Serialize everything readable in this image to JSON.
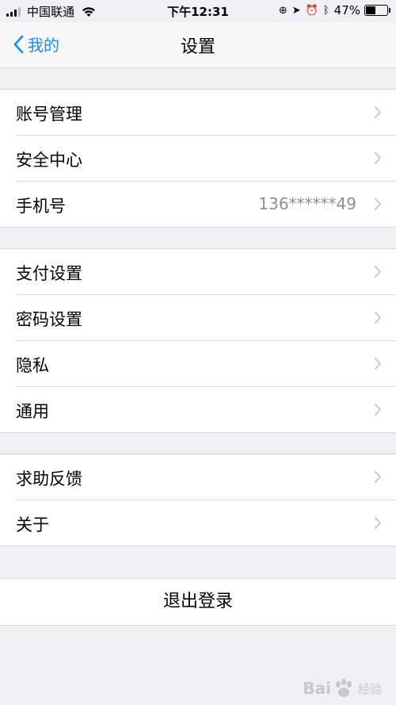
{
  "status_bar": {
    "carrier": "中国联通",
    "time": "下午12:31",
    "battery_percent": "47%",
    "battery_level": 0.47
  },
  "nav": {
    "back_label": "我的",
    "title": "设置"
  },
  "groups": [
    {
      "items": [
        {
          "label": "账号管理",
          "value": ""
        },
        {
          "label": "安全中心",
          "value": ""
        },
        {
          "label": "手机号",
          "value": "136******49"
        }
      ]
    },
    {
      "items": [
        {
          "label": "支付设置",
          "value": ""
        },
        {
          "label": "密码设置",
          "value": ""
        },
        {
          "label": "隐私",
          "value": ""
        },
        {
          "label": "通用",
          "value": ""
        }
      ]
    },
    {
      "items": [
        {
          "label": "求助反馈",
          "value": ""
        },
        {
          "label": "关于",
          "value": ""
        }
      ]
    }
  ],
  "logout_label": "退出登录",
  "watermark": {
    "brand_left": "Bai",
    "brand_right": "经验"
  },
  "colors": {
    "accent": "#1a8cf0",
    "background": "#efeff4",
    "secondary_text": "#8e8e93"
  }
}
